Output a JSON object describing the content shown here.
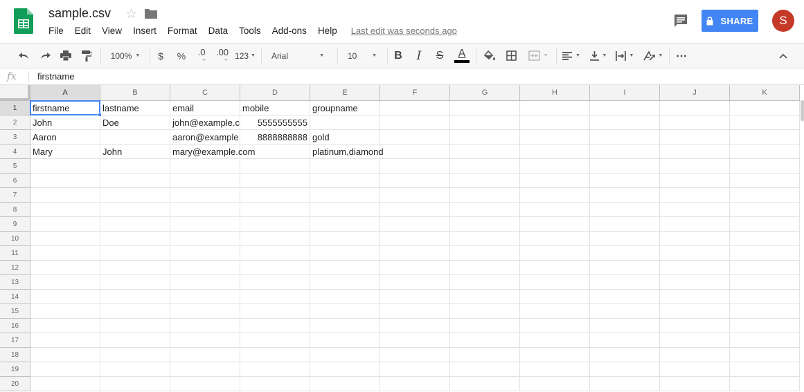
{
  "header": {
    "title": "sample.csv",
    "menus": [
      "File",
      "Edit",
      "View",
      "Insert",
      "Format",
      "Data",
      "Tools",
      "Add-ons",
      "Help"
    ],
    "last_edit": "Last edit was seconds ago",
    "share_label": "SHARE",
    "avatar_initial": "S"
  },
  "toolbar": {
    "zoom": "100%",
    "currency": "$",
    "percent": "%",
    "decrease_decimal": ".0",
    "increase_decimal": ".00",
    "more_formats": "123",
    "font": "Arial",
    "font_size": "10",
    "bold": "B",
    "italic": "I",
    "strikethrough": "S",
    "text_color_glyph": "A",
    "more": "⋯"
  },
  "formula_bar": {
    "fx": "fx",
    "value": "firstname"
  },
  "sheet": {
    "columns": [
      "A",
      "B",
      "C",
      "D",
      "E",
      "F",
      "G",
      "H",
      "I",
      "J",
      "K"
    ],
    "rows": [
      "1",
      "2",
      "3",
      "4",
      "5",
      "6",
      "7",
      "8",
      "9",
      "10",
      "11",
      "12",
      "13",
      "14",
      "15",
      "16",
      "17",
      "18",
      "19",
      "20"
    ],
    "cells": [
      [
        "firstname",
        "lastname",
        "email",
        "mobile",
        "groupname"
      ],
      [
        "John",
        "Doe",
        "john@example.c",
        "5555555555",
        ""
      ],
      [
        "Aaron",
        "",
        "aaron@example",
        "8888888888",
        "gold"
      ],
      [
        "Mary",
        "John",
        "mary@example.com",
        "",
        "platinum,diamond"
      ]
    ],
    "selected_cell": "A1"
  },
  "colors": {
    "accent": "#4285f4",
    "logo": "#0f9d58",
    "avatar": "#c53929"
  }
}
